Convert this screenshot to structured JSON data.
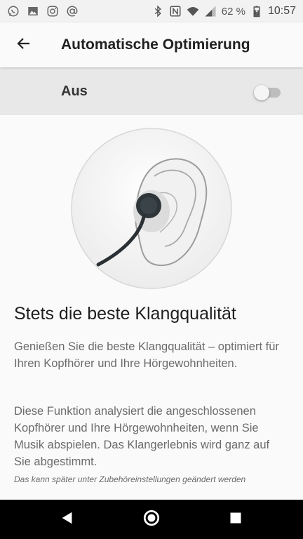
{
  "status_bar": {
    "time": "10:57",
    "battery_percent": "62 %",
    "left_icons": [
      "whatsapp-icon",
      "image-icon",
      "instagram-icon",
      "at-sign-icon"
    ],
    "right_icons": [
      "bluetooth-icon",
      "nfc-icon",
      "wifi-icon",
      "cell-signal-icon",
      "battery-icon"
    ]
  },
  "app_bar": {
    "title": "Automatische Optimierung",
    "back_icon": "arrow-back-icon"
  },
  "toggle": {
    "label": "Aus",
    "on": false
  },
  "content": {
    "headline": "Stets die beste Klangqualität",
    "paragraph1": "Genießen Sie die beste Klangqualität – optimiert für Ihren Kopfhörer und Ihre Hörgewohnheiten.",
    "paragraph2": "Diese Funktion analysiert die angeschlossenen Kopfhörer und Ihre Hörgewohnheiten, wenn Sie Musik abspielen. Das Klangerlebnis wird ganz auf Sie abgestimmt.",
    "footnote": "Das kann später unter Zubehöreinstellungen geändert werden"
  },
  "nav_bar": {
    "icons": [
      "back-triangle-icon",
      "home-circle-icon",
      "recents-square-icon"
    ]
  },
  "colors": {
    "toggle_row_bg": "#e8e8e8",
    "nav_bar_bg": "#000000",
    "switch_track_off": "#bdbdbd"
  }
}
